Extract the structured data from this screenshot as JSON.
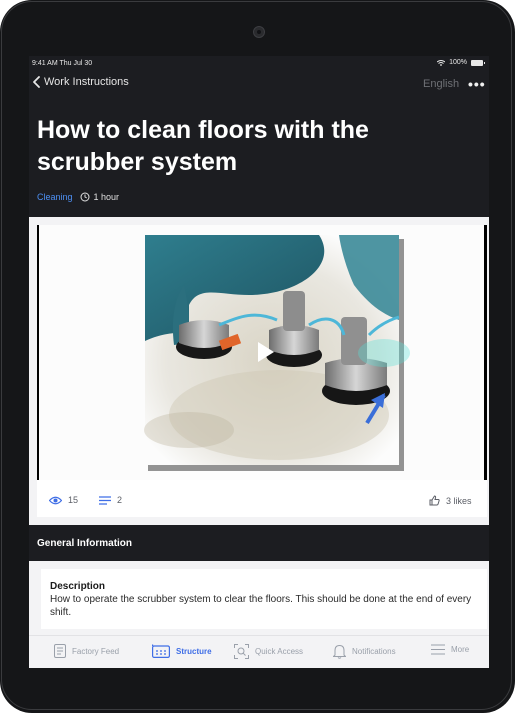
{
  "status": {
    "time": "9:41 AM  Thu Jul 30",
    "battery": "100%"
  },
  "nav": {
    "back_label": "Work Instructions",
    "language": "English"
  },
  "instruction": {
    "title": "How to clean floors with the scrubber system",
    "category": "Cleaning",
    "duration": "1 hour"
  },
  "video": {
    "views": "15",
    "steps": "2",
    "likes": "3 likes"
  },
  "general": {
    "header": "General Information",
    "description_label": "Description",
    "description_text": "How to operate the scrubber system to clear the floors. This should be done at the end of every shift."
  },
  "tabs": [
    {
      "label": "Factory Feed",
      "icon": "feed-icon"
    },
    {
      "label": "Structure",
      "icon": "structure-icon",
      "active": true
    },
    {
      "label": "Quick Access",
      "icon": "scan-icon"
    },
    {
      "label": "Notifications",
      "icon": "bell-icon"
    },
    {
      "label": "More",
      "icon": "menu-icon"
    }
  ],
  "colors": {
    "accent": "#3f6ee6",
    "category": "#4d8ff3",
    "dark": "#1c1d21"
  }
}
